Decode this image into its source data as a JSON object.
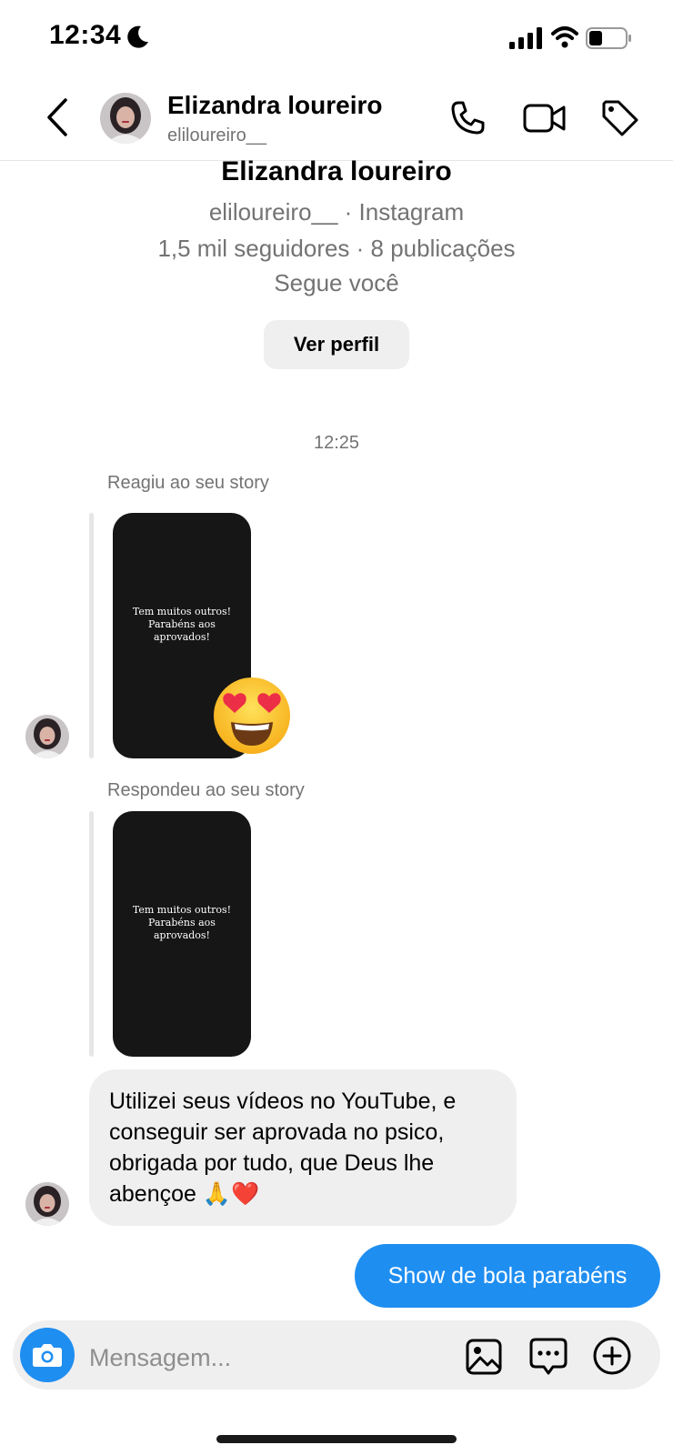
{
  "status_bar": {
    "time": "12:34"
  },
  "header": {
    "name": "Elizandra loureiro",
    "username": "eliloureiro__"
  },
  "profile": {
    "name": "Elizandra loureiro",
    "meta": "eliloureiro__ · Instagram",
    "stats": "1,5 mil seguidores · 8 publicações",
    "follow_status": "Segue você",
    "view_profile_label": "Ver perfil"
  },
  "thread": {
    "timestamp": "12:25",
    "story_reaction": {
      "label": "Reagiu ao seu story",
      "story_text": "Tem muitos outros! Parabéns aos aprovados!",
      "reaction_emoji": "heart-eyes"
    },
    "story_reply": {
      "label": "Respondeu ao seu story",
      "story_text": "Tem muitos outros! Parabéns aos aprovados!"
    },
    "incoming_message": "Utilizei seus vídeos no YouTube, e conseguir ser aprovada no psico, obrigada por tudo, que Deus lhe abençoe 🙏❤️",
    "outgoing_message": "Show de bola parabéns"
  },
  "composer": {
    "placeholder": "Mensagem..."
  },
  "colors": {
    "accent": "#1f8ef1",
    "bubble_in": "#efefef",
    "muted_text": "#737373"
  }
}
